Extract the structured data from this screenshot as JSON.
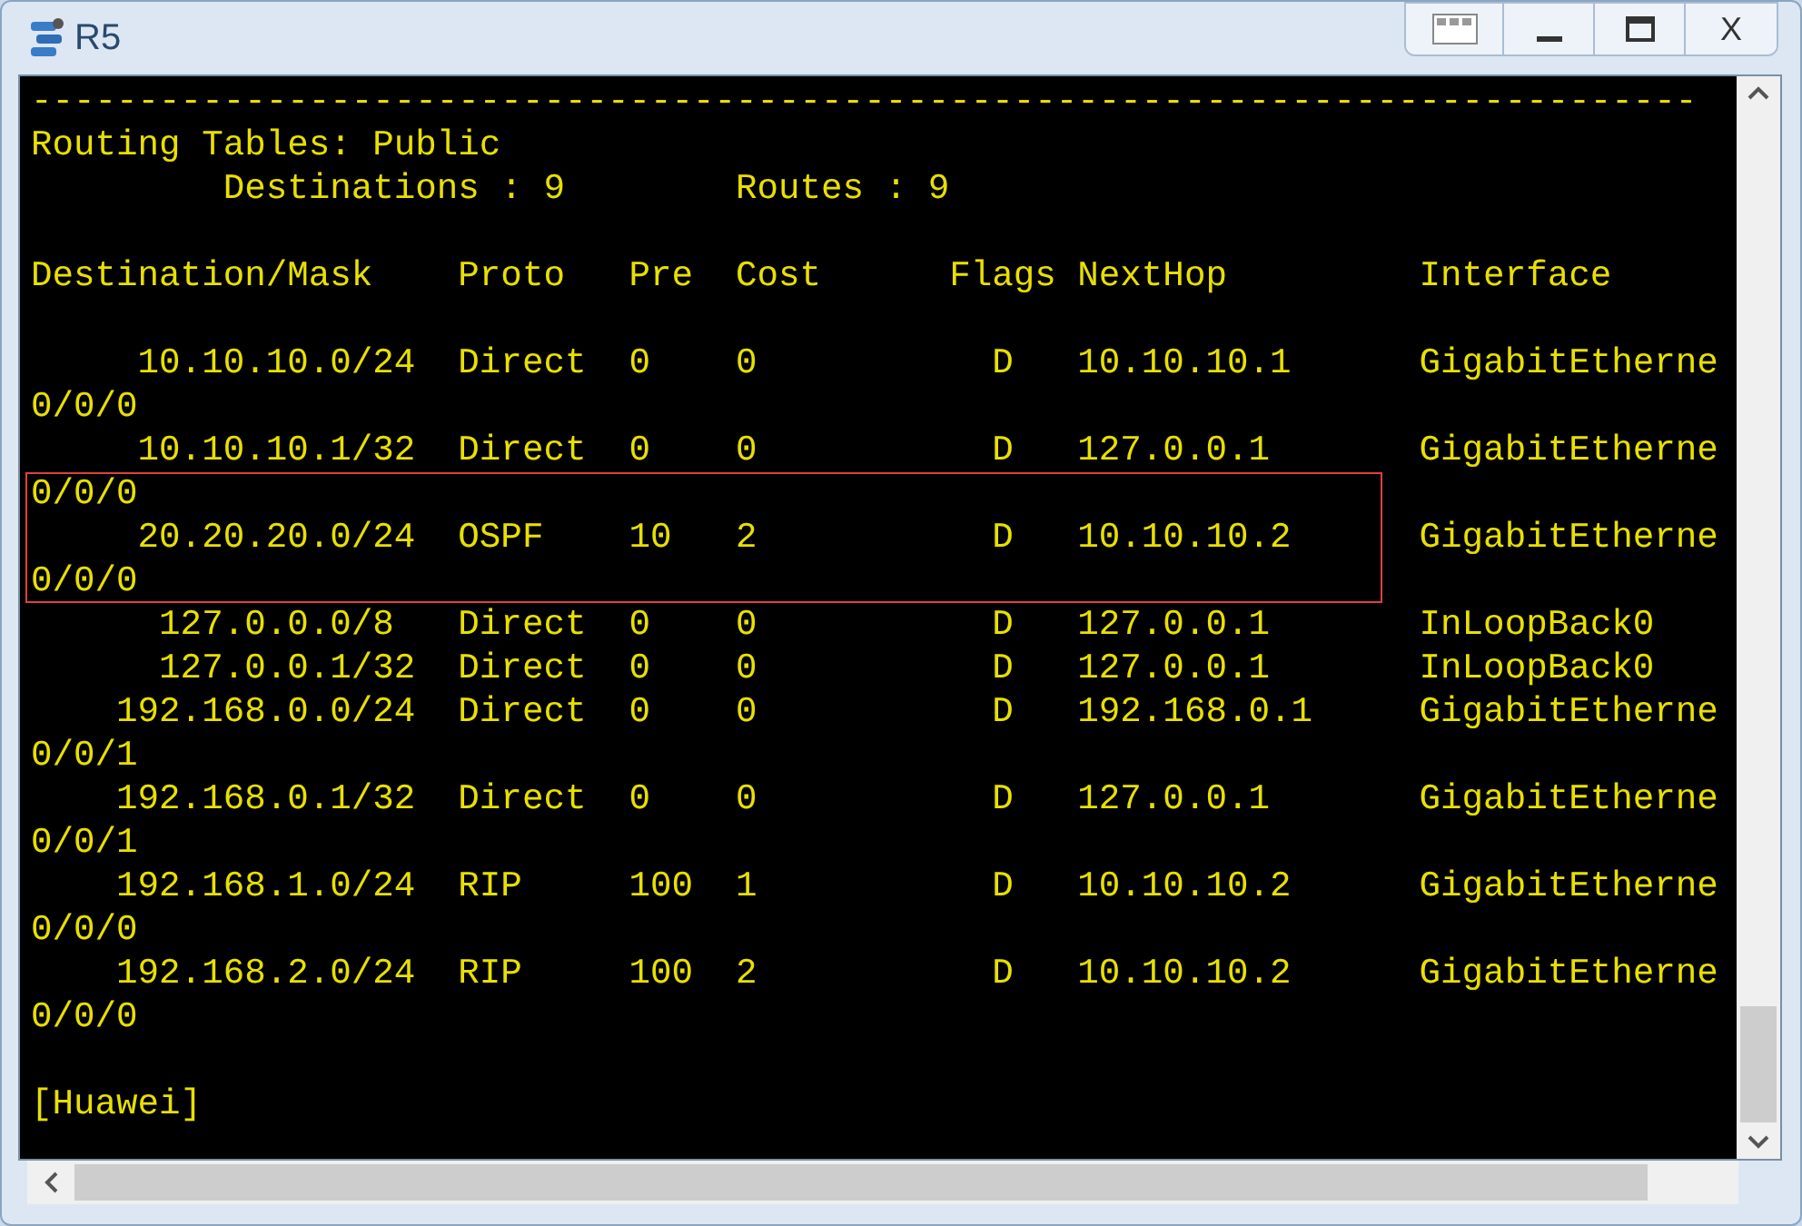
{
  "window": {
    "title": "R5",
    "close_label": "X"
  },
  "terminal": {
    "lines": [
      {
        "text": "------------------------------------------------------------------------------",
        "highlighted": false
      },
      {
        "text": "Routing Tables: Public",
        "highlighted": false
      },
      {
        "text": "         Destinations : 9        Routes : 9",
        "highlighted": false
      },
      {
        "text": "Destination/Mask    Proto   Pre  Cost      Flags NextHop         Interface",
        "highlighted": false,
        "blank_line_before": true
      },
      {
        "text": "     10.10.10.0/24  Direct  0    0           D   10.10.10.1      GigabitEtherne",
        "highlighted": false,
        "blank_line_before": true
      },
      {
        "text": "0/0/0",
        "highlighted": false
      },
      {
        "text": "     10.10.10.1/32  Direct  0    0           D   127.0.0.1       GigabitEtherne",
        "highlighted": false
      },
      {
        "text": "0/0/0",
        "highlighted": true
      },
      {
        "text": "     20.20.20.0/24  OSPF    10   2           D   10.10.10.2      GigabitEtherne",
        "highlighted": true
      },
      {
        "text": "0/0/0",
        "highlighted": true
      },
      {
        "text": "      127.0.0.0/8   Direct  0    0           D   127.0.0.1       InLoopBack0",
        "highlighted": false
      },
      {
        "text": "      127.0.0.1/32  Direct  0    0           D   127.0.0.1       InLoopBack0",
        "highlighted": false
      },
      {
        "text": "    192.168.0.0/24  Direct  0    0           D   192.168.0.1     GigabitEtherne",
        "highlighted": false
      },
      {
        "text": "0/0/1",
        "highlighted": false
      },
      {
        "text": "    192.168.0.1/32  Direct  0    0           D   127.0.0.1       GigabitEtherne",
        "highlighted": false
      },
      {
        "text": "0/0/1",
        "highlighted": false
      },
      {
        "text": "    192.168.1.0/24  RIP     100  1           D   10.10.10.2      GigabitEtherne",
        "highlighted": false
      },
      {
        "text": "0/0/0",
        "highlighted": false
      },
      {
        "text": "    192.168.2.0/24  RIP     100  2           D   10.10.10.2      GigabitEtherne",
        "highlighted": false
      },
      {
        "text": "0/0/0",
        "highlighted": false
      },
      {
        "text": "[Huawei]",
        "highlighted": false,
        "blank_line_before": true
      }
    ]
  }
}
